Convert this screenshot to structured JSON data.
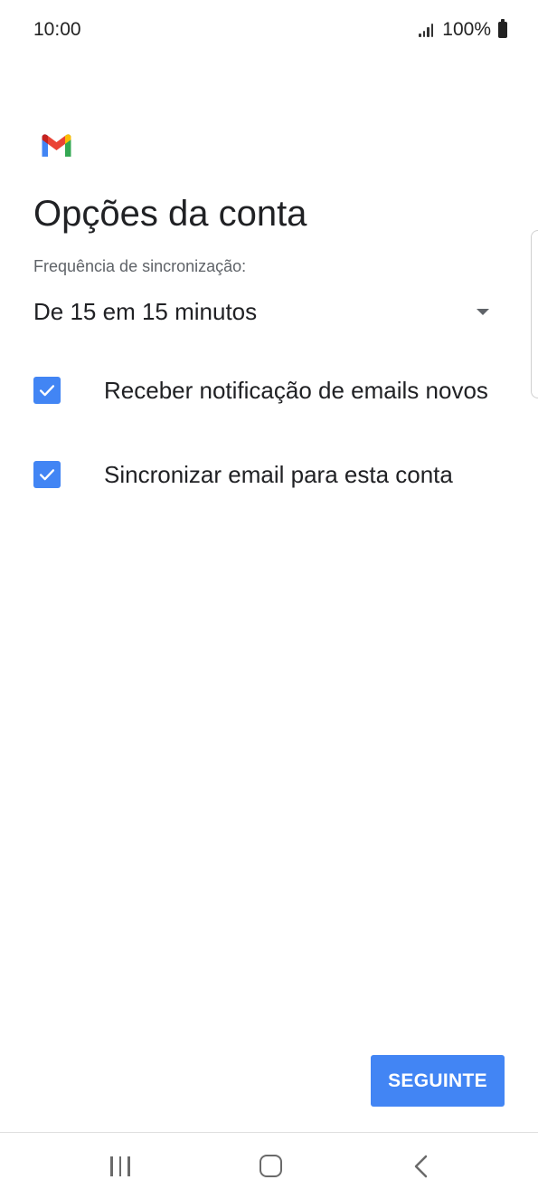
{
  "status_bar": {
    "time": "10:00",
    "battery": "100%",
    "signal_icon": "signal-bars-icon",
    "battery_icon": "battery-full-icon"
  },
  "app": {
    "logo": "gmail-logo",
    "title": "Opções da conta"
  },
  "sync_frequency": {
    "label": "Frequência de sincronização:",
    "selected": "De 15 em 15 minutos",
    "icon": "dropdown-arrow-icon"
  },
  "options": [
    {
      "label": "Receber notificação de emails novos",
      "checked": true
    },
    {
      "label": "Sincronizar email para esta conta",
      "checked": true
    }
  ],
  "actions": {
    "next_label": "SEGUINTE"
  },
  "nav_bar": {
    "recents_icon": "recents-icon",
    "home_icon": "home-icon",
    "back_icon": "back-icon"
  },
  "colors": {
    "accent": "#4285f4",
    "text_primary": "#202124",
    "text_secondary": "#5f6368"
  }
}
